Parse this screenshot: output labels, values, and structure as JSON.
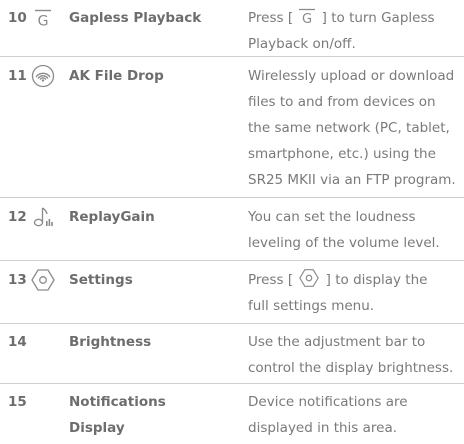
{
  "rows": [
    {
      "number": "10",
      "icon": "gapless-playback-icon",
      "name": "Gapless Playback",
      "desc_pre": "Press [ ",
      "desc_post": " ] to turn Gapless",
      "desc_line2": "Playback on/off."
    },
    {
      "number": "11",
      "icon": "wireless-file-drop-icon",
      "name": "AK File Drop",
      "desc_lines": [
        "Wirelessly upload or download",
        "files to and from devices on",
        "the same network (PC, tablet,",
        "smartphone, etc.) using the",
        "SR25 MKII via an FTP program."
      ]
    },
    {
      "number": "12",
      "icon": "replaygain-icon",
      "name": "ReplayGain",
      "desc_lines": [
        "You can set the loudness",
        "leveling of the volume level."
      ]
    },
    {
      "number": "13",
      "icon": "settings-icon",
      "name": "Settings",
      "desc_pre": "Press [ ",
      "desc_post": " ] to display the",
      "desc_line2": "full settings menu."
    },
    {
      "number": "14",
      "name": "Brightness",
      "desc_lines": [
        "Use the adjustment bar to",
        "control the display brightness."
      ]
    },
    {
      "number": "15",
      "name_lines": [
        "Notifications",
        "Display"
      ],
      "desc_lines": [
        "Device notifications are",
        "displayed in this area."
      ]
    }
  ]
}
